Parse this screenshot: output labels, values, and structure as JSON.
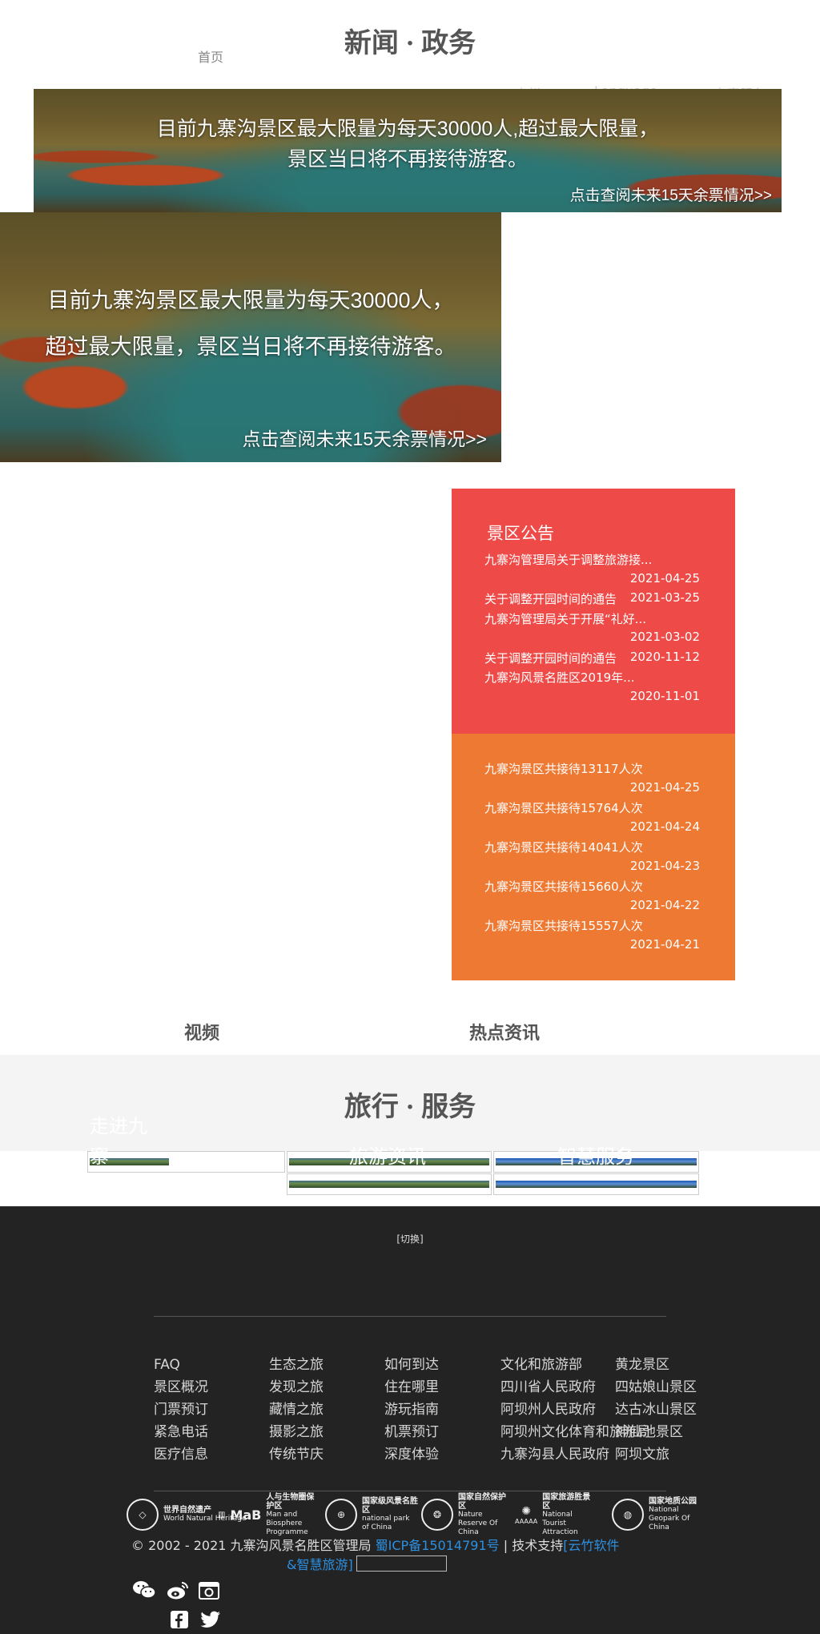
{
  "header": {
    "news_title": "新闻 · 政务",
    "home": "首页",
    "nav": [
      "专栏",
      "Language",
      "办事服务"
    ]
  },
  "banner": {
    "line1": "目前九寨沟景区最大限量为每天30000人，",
    "line2": "超过最大限量，景区当日将不再接待游客。",
    "top_line1": "目前九寨沟景区最大限量为每天30000人,超过最大限量，",
    "top_line2": "景区当日将不再接待游客。",
    "link": "点击查阅未来15天余票情况>>"
  },
  "notices": {
    "heading": "景区公告",
    "items": [
      {
        "title": "九寨沟管理局关于调整旅游接...",
        "date": "2021-04-25"
      },
      {
        "title": "关于调整开园时间的通告",
        "date": "2021-03-25"
      },
      {
        "title": "九寨沟管理局关于开展“礼好...",
        "date": "2021-03-02"
      },
      {
        "title": "关于调整开园时间的通告",
        "date": "2020-11-12"
      },
      {
        "title": "九寨沟风景名胜区2019年...",
        "date": "2020-11-01"
      }
    ]
  },
  "stats": {
    "items": [
      {
        "title": "九寨沟景区共接待13117人次",
        "date": "2021-04-25"
      },
      {
        "title": "九寨沟景区共接待15764人次",
        "date": "2021-04-24"
      },
      {
        "title": "九寨沟景区共接待14041人次",
        "date": "2021-04-23"
      },
      {
        "title": "九寨沟景区共接待15660人次",
        "date": "2021-04-22"
      },
      {
        "title": "九寨沟景区共接待15557人次",
        "date": "2021-04-21"
      }
    ]
  },
  "sections": {
    "video": "视频",
    "hot_news": "热点资讯"
  },
  "travel": {
    "title": "旅行 · 服务",
    "ghost_left_1": "走进九",
    "ghost_left_2": "寨",
    "ghost_mid": "旅游资讯",
    "ghost_right": "智慧服务"
  },
  "footer": {
    "toggle": "[切换]",
    "col1": [
      "FAQ",
      "景区概况",
      "门票预订",
      "紧急电话",
      "医疗信息"
    ],
    "col2": [
      "生态之旅",
      "发现之旅",
      "藏情之旅",
      "摄影之旅",
      "传统节庆"
    ],
    "col3": [
      "如何到达",
      "住在哪里",
      "游玩指南",
      "机票预订",
      "深度体验"
    ],
    "col4": [
      "文化和旅游部",
      "四川省人民政府",
      "阿坝州人民政府",
      "阿坝州文化体育和旅游局",
      "九寨沟县人民政府"
    ],
    "col5": [
      "黄龙景区",
      "四姑娘山景区",
      "达古冰山景区",
      "神仙池景区",
      "阿坝文旅"
    ],
    "logos": [
      {
        "cn": "世界自然遗产",
        "en": "World Natural Heritage"
      },
      {
        "cn": "人与生物圈保护区",
        "en": "Man and Biosphere Programme"
      },
      {
        "cn": "国家级风景名胜区",
        "en": "national park of China"
      },
      {
        "cn": "国家自然保护区",
        "en": "Nature Reserve Of China"
      },
      {
        "cn": "国家旅游胜景区",
        "en": "National Tourist Attraction"
      },
      {
        "cn": "国家地质公园",
        "en": "National Geopark Of China"
      }
    ],
    "mab": "MaB",
    "aaaaa": "AAAAA",
    "copyright": "© 2002 - 2021 九寨沟风景名胜区管理局",
    "icp": "蜀ICP备15014791号",
    "tech_prefix": "| 技术支持",
    "tech_link1": "[云竹软件",
    "tech_link2": "&智慧旅游]"
  }
}
